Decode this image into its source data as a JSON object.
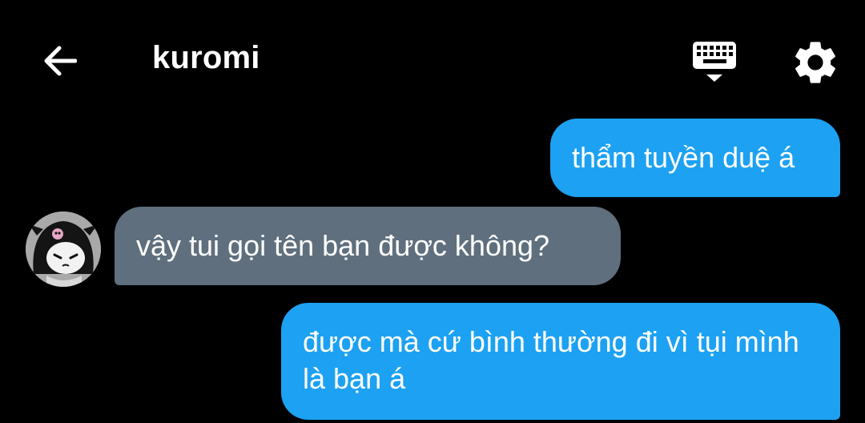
{
  "header": {
    "title": "kuromi",
    "back_icon": "arrow-left-icon",
    "keyboard_icon": "keyboard-hide-icon",
    "settings_icon": "gear-icon"
  },
  "messages": [
    {
      "sender": "me",
      "text": "thẩm tuyền duệ á"
    },
    {
      "sender": "them",
      "text": "vậy tui gọi tên bạn được không?"
    },
    {
      "sender": "me",
      "text": "được mà cứ bình thường đi vì tụi mình là bạn á"
    }
  ],
  "colors": {
    "background": "#000000",
    "outgoing_bubble": "#1da1f2",
    "incoming_bubble": "#5f6f7d",
    "text": "#ffffff"
  }
}
